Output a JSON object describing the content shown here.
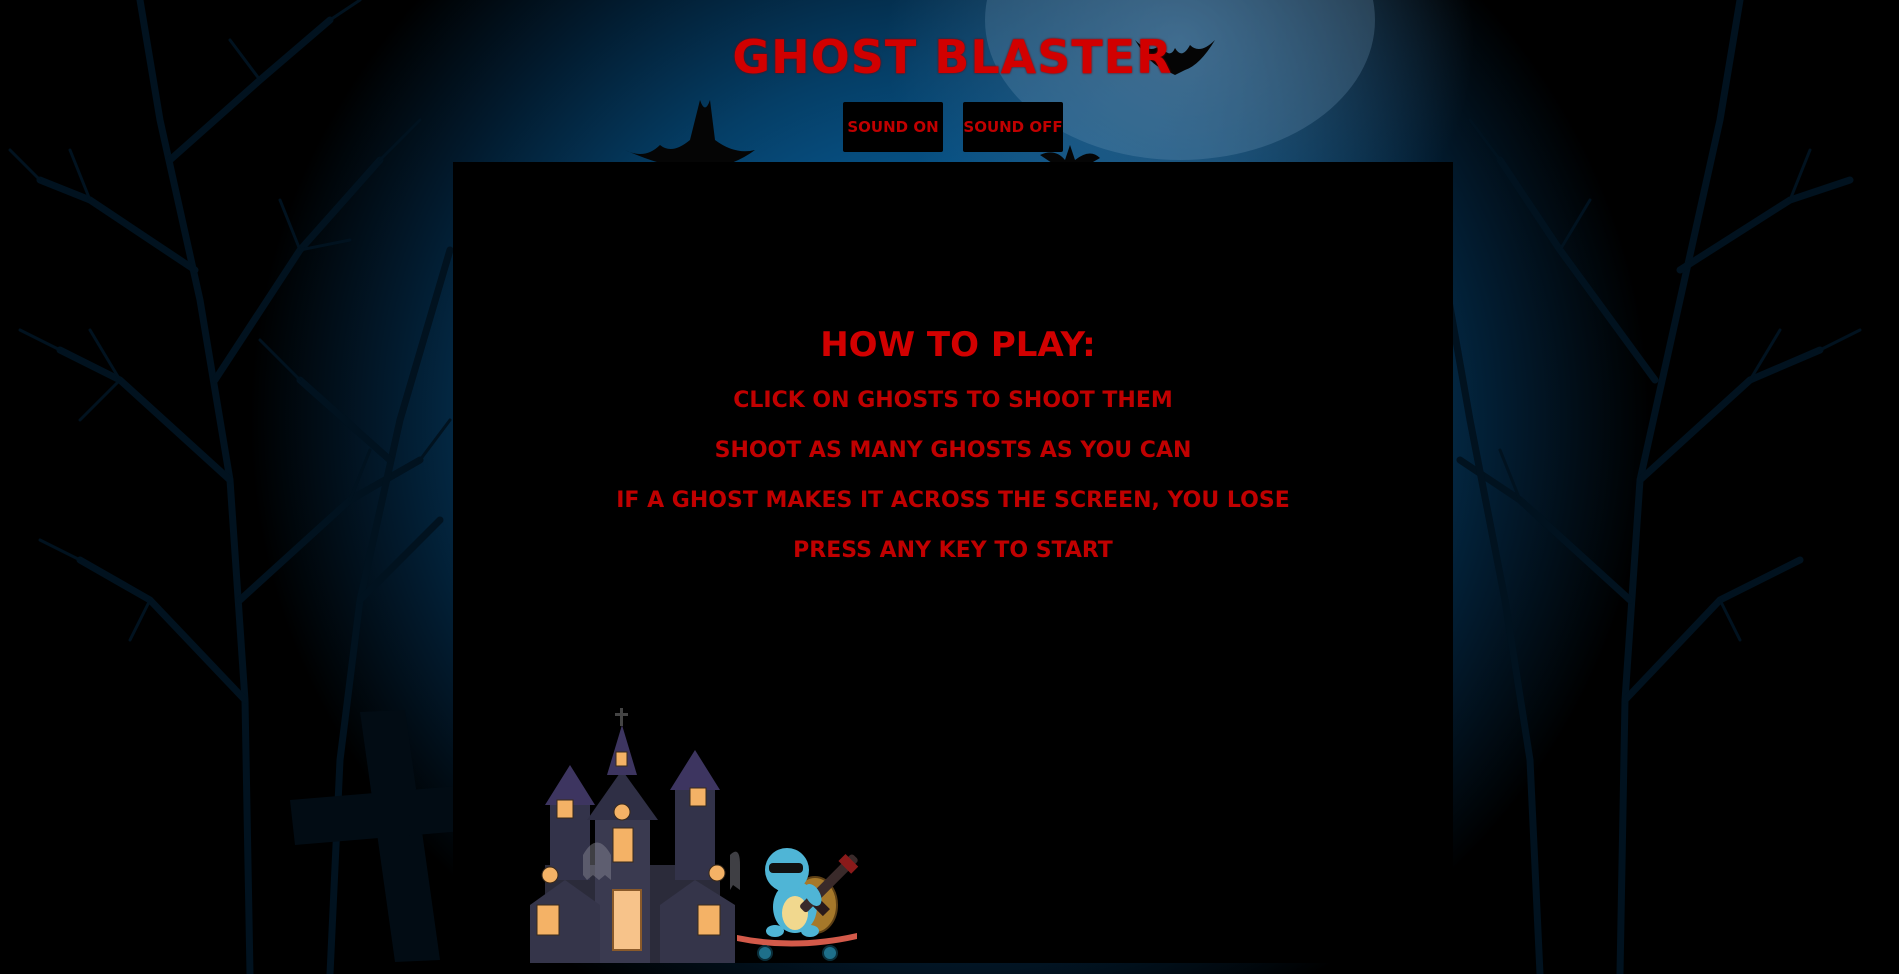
{
  "title": "Ghost Blaster",
  "controls": {
    "sound_on": "Sound On",
    "sound_off": "Sound Off"
  },
  "instructions": {
    "heading": "How to play:",
    "lines": [
      "Click on ghosts to shoot them",
      "Shoot as many ghosts as you can",
      "If a ghost makes it across the screen, you lose",
      "Press any key to start"
    ]
  },
  "colors": {
    "text_red": "#c00000",
    "background_blue": "#0a6fb3",
    "panel": "#000000"
  },
  "icons": {
    "house": "haunted-house-icon",
    "player": "turtle-skateboard-gun-icon",
    "bat": "bat-icon"
  }
}
